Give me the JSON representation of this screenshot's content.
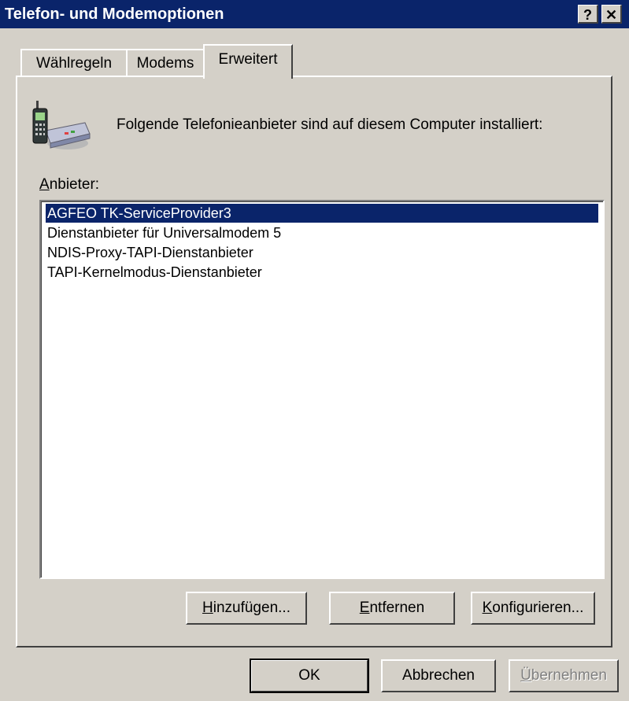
{
  "window": {
    "title": "Telefon- und Modemoptionen",
    "help_label": "?",
    "close_label": "✕"
  },
  "tabs": [
    {
      "label": "Wählregeln"
    },
    {
      "label": "Modems"
    },
    {
      "label": "Erweitert",
      "active": true
    }
  ],
  "advanced": {
    "intro_text": "Folgende Telefonieanbieter sind auf diesem Computer installiert:",
    "list_label_key": "A",
    "list_label_rest": "nbieter:",
    "providers": [
      "AGFEO TK-ServiceProvider3",
      "Dienstanbieter für Universalmodem 5",
      "NDIS-Proxy-TAPI-Dienstanbieter",
      "TAPI-Kernelmodus-Dienstanbieter"
    ],
    "selected_provider": "AGFEO TK-ServiceProvider3",
    "buttons": {
      "add_key": "H",
      "add_rest": "inzufügen...",
      "remove_key": "E",
      "remove_rest": "ntfernen",
      "configure_key": "K",
      "configure_rest": "onfigurieren..."
    }
  },
  "dialog_buttons": {
    "ok": "OK",
    "cancel": "Abbrechen",
    "apply_key": "Ü",
    "apply_rest": "bernehmen"
  },
  "icon": "phone-modem-icon"
}
